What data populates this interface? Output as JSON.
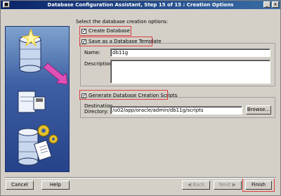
{
  "window": {
    "title": "Database Configuration Assistant, Step 15 of 15 : Creation Options"
  },
  "prompt": "Select the database creation options:",
  "options": {
    "create_database": {
      "label": "Create Database",
      "checked": true
    },
    "save_template": {
      "label": "Save as a Database Template",
      "checked": true
    },
    "generate_scripts": {
      "label": "Generate Database Creation Scripts",
      "checked": true
    }
  },
  "template": {
    "name_label": "Name:",
    "name_value": "db11g",
    "description_label": "Description:",
    "description_value": ""
  },
  "scripts": {
    "destination_label_line1": "Destination",
    "destination_label_line2": "Directory:",
    "destination_value": "/u02/app/oracle/admin/db11g/scripts",
    "browse_label": "Browse..."
  },
  "footer": {
    "cancel": "Cancel",
    "help": "Help",
    "back": "Back",
    "next": "Next",
    "finish": "Finish"
  },
  "icons": {
    "back_arrow": "◀",
    "next_arrow": "▶",
    "check": "✓"
  }
}
